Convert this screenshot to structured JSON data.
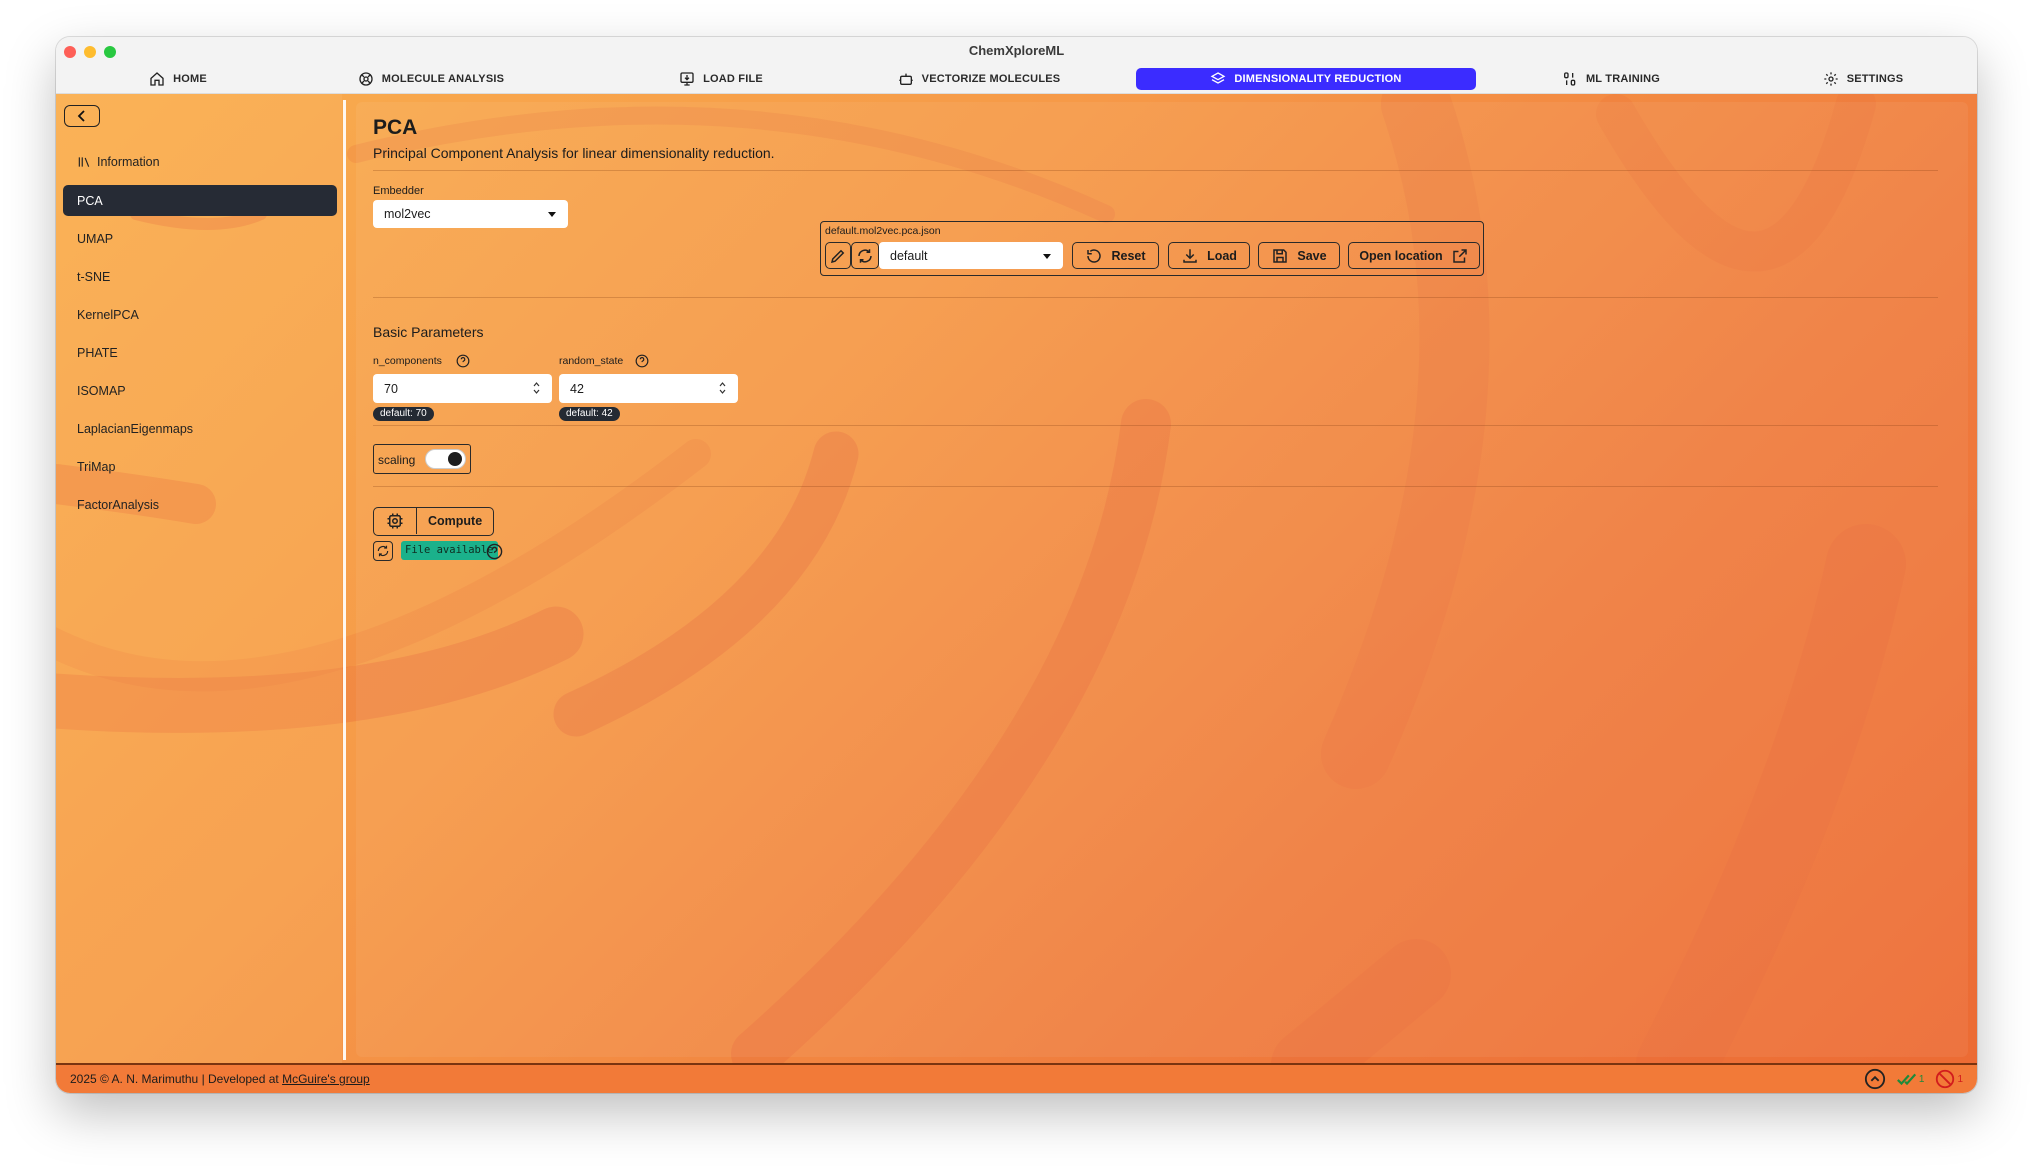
{
  "window": {
    "title": "ChemXploreML"
  },
  "tabs": [
    {
      "label": "HOME",
      "icon": "home-icon"
    },
    {
      "label": "MOLECULE ANALYSIS",
      "icon": "molecule-icon"
    },
    {
      "label": "LOAD FILE",
      "icon": "load-file-icon"
    },
    {
      "label": "VECTORIZE MOLECULES",
      "icon": "robot-icon"
    },
    {
      "label": "DIMENSIONALITY REDUCTION",
      "icon": "layers-icon",
      "active": true
    },
    {
      "label": "ML TRAINING",
      "icon": "binary-icon"
    },
    {
      "label": "SETTINGS",
      "icon": "gear-icon"
    }
  ],
  "sidebar": {
    "items": [
      {
        "label": "Information",
        "icon": "library-icon"
      },
      {
        "label": "PCA",
        "active": true
      },
      {
        "label": "UMAP"
      },
      {
        "label": "t-SNE"
      },
      {
        "label": "KernelPCA"
      },
      {
        "label": "PHATE"
      },
      {
        "label": "ISOMAP"
      },
      {
        "label": "LaplacianEigenmaps"
      },
      {
        "label": "TriMap"
      },
      {
        "label": "FactorAnalysis"
      }
    ]
  },
  "main": {
    "title": "PCA",
    "description": "Principal Component Analysis for linear dimensionality reduction.",
    "embedder": {
      "label": "Embedder",
      "value": "mol2vec"
    },
    "config": {
      "filename": "default.mol2vec.pca.json",
      "selected": "default",
      "reset_label": "Reset",
      "load_label": "Load",
      "save_label": "Save",
      "open_location_label": "Open location"
    },
    "basic_params": {
      "heading": "Basic Parameters",
      "n_components": {
        "label": "n_components",
        "value": "70",
        "default": "default: 70"
      },
      "random_state": {
        "label": "random_state",
        "value": "42",
        "default": "default: 42"
      }
    },
    "scaling": {
      "label": "scaling",
      "on": true
    },
    "compute_label": "Compute",
    "file_status": "File available"
  },
  "footer": {
    "text": "2025 © A. N. Marimuthu | Developed at ",
    "link": "McGuire's group",
    "success_count": "1",
    "error_count": "1"
  },
  "colors": {
    "accent": "#3b2cff",
    "background_start": "#f9ae4f",
    "background_end": "#ec6b34",
    "sidebar_active": "#262b35",
    "file_available": "#1bb18b"
  }
}
